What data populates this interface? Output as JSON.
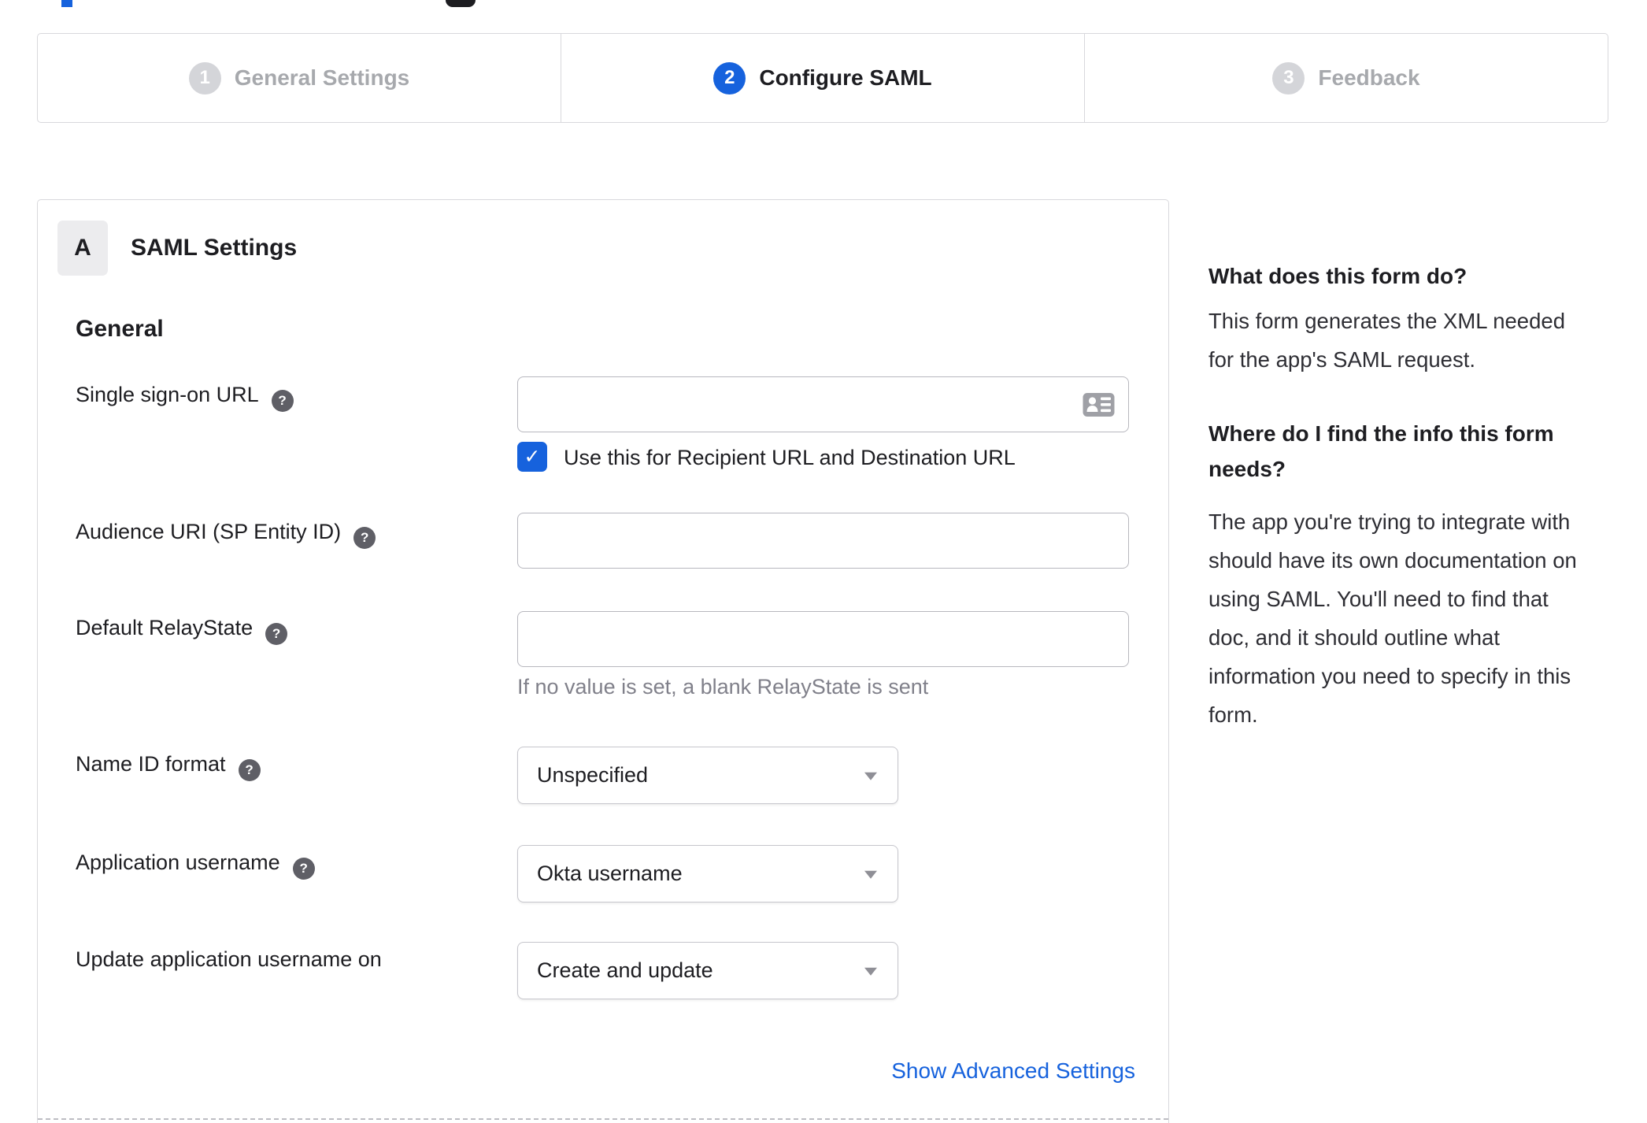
{
  "colors": {
    "accent_blue": "#1662dd",
    "inactive_step_gray": "#d4d5d9",
    "border_gray": "#d8d8dc",
    "helper_text_gray": "#80808a"
  },
  "icons": {
    "help": "?",
    "checkbox_check": "✓",
    "contact_card": "contact-card",
    "dropdown_caret": "caret-down"
  },
  "stepper": {
    "steps": [
      {
        "number": "1",
        "label": "General Settings",
        "active": false
      },
      {
        "number": "2",
        "label": "Configure SAML",
        "active": true
      },
      {
        "number": "3",
        "label": "Feedback",
        "active": false
      }
    ]
  },
  "saml_panel": {
    "badge": "A",
    "title": "SAML Settings",
    "section": "General",
    "sso": {
      "label": "Single sign-on URL",
      "value": "",
      "checkbox_label": "Use this for Recipient URL and Destination URL",
      "checked": true
    },
    "audience": {
      "label": "Audience URI (SP Entity ID)",
      "value": ""
    },
    "relay": {
      "label": "Default RelayState",
      "value": "",
      "helper": "If no value is set, a blank RelayState is sent"
    },
    "name_id": {
      "label": "Name ID format",
      "value": "Unspecified"
    },
    "app_username": {
      "label": "Application username",
      "value": "Okta username"
    },
    "update_username": {
      "label": "Update application username on",
      "value": "Create and update"
    },
    "advanced_link": "Show Advanced Settings"
  },
  "sidebar_help": {
    "q1": "What does this form do?",
    "a1": "This form generates the XML needed for the app's SAML request.",
    "q2": "Where do I find the info this form needs?",
    "a2": "The app you're trying to integrate with should have its own documentation on using SAML. You'll need to find that doc, and it should outline what information you need to specify in this form."
  }
}
